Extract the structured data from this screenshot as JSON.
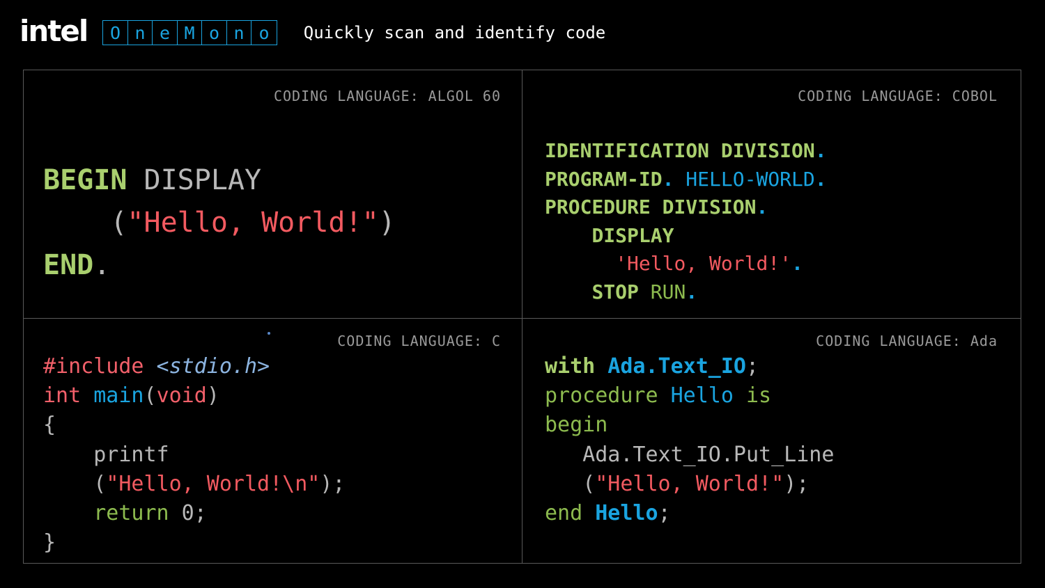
{
  "header": {
    "logo": "intel",
    "brand_letters": [
      "O",
      "n",
      "e",
      "M",
      "o",
      "n",
      "o"
    ],
    "tagline": "Quickly scan and identify code"
  },
  "panels": {
    "algol": {
      "label": "CODING LANGUAGE: ALGOL 60",
      "lines": {
        "l1_kw": "BEGIN",
        "l1_rest": " DISPLAY",
        "l2_indent": "    ",
        "l2_open": "(",
        "l2_str": "\"Hello, World!\"",
        "l2_close": ")",
        "l3_kw": "END",
        "l3_dot": "."
      }
    },
    "cobol": {
      "label": "CODING LANGUAGE: COBOL",
      "lines": {
        "l1_kw": "IDENTIFICATION DIVISION",
        "l1_dot": ".",
        "l2_kw": "PROGRAM-ID",
        "l2_dot": ".",
        "l2_val": " HELLO-WORLD",
        "l2_dot2": ".",
        "l3_kw": "PROCEDURE DIVISION",
        "l3_dot": ".",
        "l4_indent": "    ",
        "l4_kw": "DISPLAY",
        "l5_indent": "      ",
        "l5_str": "'Hello, World!'",
        "l5_dot": ".",
        "l6_indent": "    ",
        "l6_kw": "STOP",
        "l6_rest": " RUN",
        "l6_dot": "."
      }
    },
    "c": {
      "label": "CODING LANGUAGE: C",
      "lines": {
        "l1_directive": "#include",
        "l1_header": " <stdio.h>",
        "l2_type": "int",
        "l2_func": " main",
        "l2_open": "(",
        "l2_arg": "void",
        "l2_close": ")",
        "l3": "{",
        "l4": "    printf",
        "l5_indent": "    ",
        "l5_open": "(",
        "l5_str": "\"Hello, World!\\n\"",
        "l5_close": ");",
        "l6_indent": "    ",
        "l6_kw": "return",
        "l6_rest": " 0;",
        "l7": "}"
      }
    },
    "ada": {
      "label": "CODING LANGUAGE: Ada",
      "lines": {
        "l1_kw": "with",
        "l1_pkg": " Ada.Text_IO",
        "l1_semi": ";",
        "l2_kw": "procedure",
        "l2_name": " Hello",
        "l2_is": " is",
        "l3_kw": "begin",
        "l4": "   Ada.Text_IO.Put_Line",
        "l5_indent": "   ",
        "l5_open": "(",
        "l5_str": "\"Hello, World!\"",
        "l5_close": ");",
        "l6_kw": "end",
        "l6_name": " Hello",
        "l6_semi": ";"
      }
    }
  },
  "colors": {
    "background": "#000000",
    "keyword_green": "#a9cf6e",
    "string_red": "#f25a60",
    "accent_blue": "#1aa4e0",
    "plain_grey": "#b8b8b8",
    "border": "#5a5a5a"
  }
}
